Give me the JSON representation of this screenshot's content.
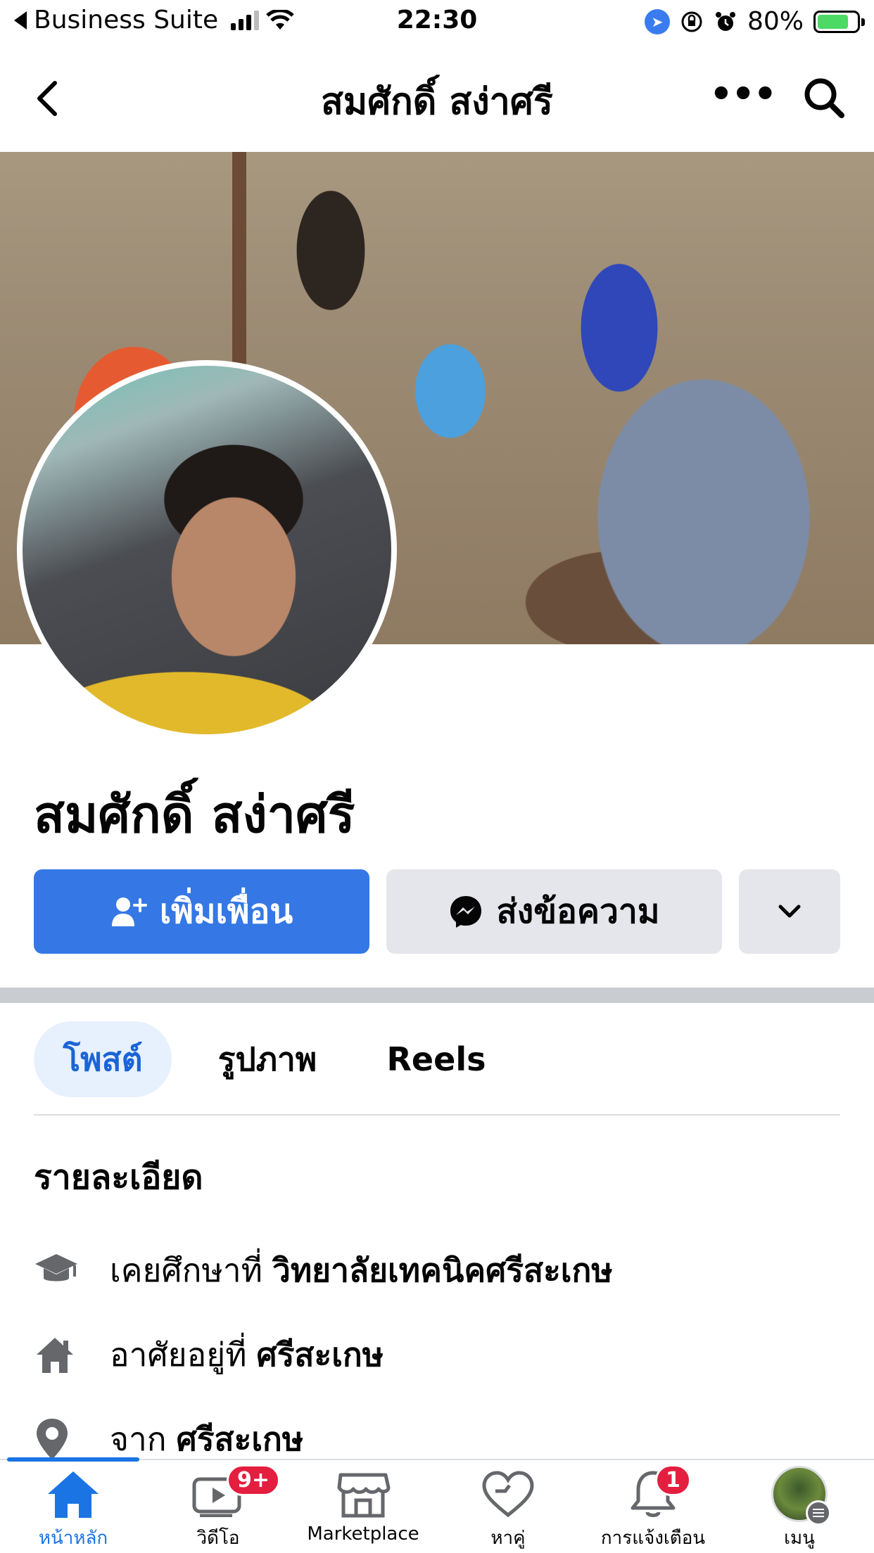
{
  "status_bar": {
    "carrier": "Business Suite",
    "time": "22:30",
    "battery": "80%",
    "battery_level": 0.8
  },
  "nav": {
    "title": "สมศักดิ์ สง่าศรี",
    "more": "•••"
  },
  "profile": {
    "name": "สมศักดิ์ สง่าศรี"
  },
  "actions": {
    "add_friend": "เพิ่มเพื่อน",
    "message": "ส่งข้อความ"
  },
  "tabs": [
    {
      "label": "โพสต์"
    },
    {
      "label": "รูปภาพ"
    },
    {
      "label": "Reels"
    }
  ],
  "details": {
    "title": "รายละเอียด",
    "education_prefix": "เคยศึกษาที่",
    "education_value": "วิทยาลัยเทคนิคศรีสะเกษ",
    "lives_prefix": "อาศัยอยู่ที่",
    "lives_value": "ศรีสะเกษ",
    "from_prefix": "จาก",
    "from_value": "ศรีสะเกษ"
  },
  "tabbar": {
    "home": "หน้าหลัก",
    "video": "วิดีโอ",
    "video_badge": "9+",
    "marketplace": "Marketplace",
    "dating": "หาคู่",
    "notifications": "การแจ้งเตือน",
    "notifications_badge": "1",
    "menu": "เมนู"
  },
  "colors": {
    "accent": "#3578e5",
    "badge": "#e41e3f",
    "tab_active_bg": "#e7f0fd"
  }
}
